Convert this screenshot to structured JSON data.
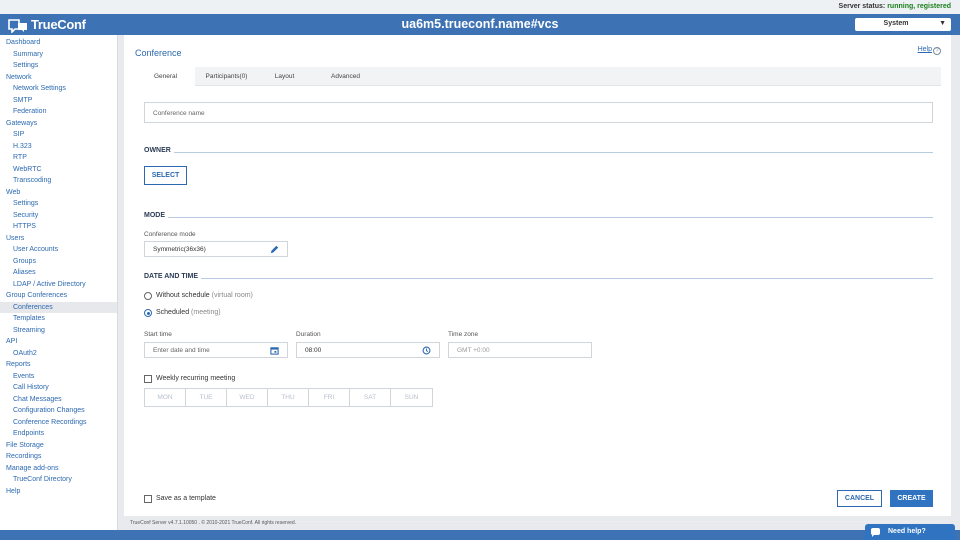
{
  "status": {
    "label": "Server status:",
    "value": "running, registered",
    "value_color": "#1a7f1a"
  },
  "header": {
    "logo_text": "TrueConf",
    "server_id": "ua6m5.trueconf.name#vcs",
    "role_select": "System",
    "bg_color": "#3d72b4"
  },
  "sidebar": [
    {
      "label": "Dashboard",
      "level": 1
    },
    {
      "label": "Summary",
      "level": 2
    },
    {
      "label": "Settings",
      "level": 2
    },
    {
      "label": "Network",
      "level": 1
    },
    {
      "label": "Network Settings",
      "level": 2
    },
    {
      "label": "SMTP",
      "level": 2
    },
    {
      "label": "Federation",
      "level": 2
    },
    {
      "label": "Gateways",
      "level": 1
    },
    {
      "label": "SIP",
      "level": 2
    },
    {
      "label": "H.323",
      "level": 2
    },
    {
      "label": "RTP",
      "level": 2
    },
    {
      "label": "WebRTC",
      "level": 2
    },
    {
      "label": "Transcoding",
      "level": 2
    },
    {
      "label": "Web",
      "level": 1
    },
    {
      "label": "Settings",
      "level": 2
    },
    {
      "label": "Security",
      "level": 2
    },
    {
      "label": "HTTPS",
      "level": 2
    },
    {
      "label": "Users",
      "level": 1
    },
    {
      "label": "User Accounts",
      "level": 2
    },
    {
      "label": "Groups",
      "level": 2
    },
    {
      "label": "Aliases",
      "level": 2
    },
    {
      "label": "LDAP / Active Directory",
      "level": 2
    },
    {
      "label": "Group Conferences",
      "level": 1
    },
    {
      "label": "Conferences",
      "level": 2,
      "active": true
    },
    {
      "label": "Templates",
      "level": 2
    },
    {
      "label": "Streaming",
      "level": 2
    },
    {
      "label": "API",
      "level": 1
    },
    {
      "label": "OAuth2",
      "level": 2
    },
    {
      "label": "Reports",
      "level": 1
    },
    {
      "label": "Events",
      "level": 2
    },
    {
      "label": "Call History",
      "level": 2
    },
    {
      "label": "Chat Messages",
      "level": 2
    },
    {
      "label": "Configuration Changes",
      "level": 2
    },
    {
      "label": "Conference Recordings",
      "level": 2
    },
    {
      "label": "Endpoints",
      "level": 2
    },
    {
      "label": "File Storage",
      "level": 1
    },
    {
      "label": "Recordings",
      "level": 1
    },
    {
      "label": "Manage add-ons",
      "level": 1
    },
    {
      "label": "TrueConf Directory",
      "level": 2
    },
    {
      "label": "Help",
      "level": 1
    }
  ],
  "page": {
    "title": "Conference",
    "help": "Help"
  },
  "tabs": [
    {
      "label": "General",
      "active": true
    },
    {
      "label": "Participants(0)"
    },
    {
      "label": "Layout"
    },
    {
      "label": "Advanced"
    }
  ],
  "form": {
    "conference_name_placeholder": "Conference name",
    "owner": {
      "section": "OWNER",
      "select_button": "SELECT"
    },
    "mode": {
      "section": "MODE",
      "label": "Conference mode",
      "value": "Symmetric(36x36)"
    },
    "datetime": {
      "section": "DATE AND TIME",
      "without_schedule": "Without schedule",
      "without_schedule_hint": "(virtual room)",
      "scheduled": "Scheduled",
      "scheduled_hint": "(meeting)",
      "start_time_label": "Start time",
      "start_time_placeholder": "Enter date and time",
      "duration_label": "Duration",
      "duration_value": "08:00",
      "timezone_label": "Time zone",
      "timezone_placeholder": "GMT +0:00",
      "weekly_label": "Weekly recurring meeting",
      "days": [
        "MON",
        "TUE",
        "WED",
        "THU",
        "FRI",
        "SAT",
        "SUN"
      ]
    },
    "save_template_label": "Save as a template",
    "cancel": "CANCEL",
    "create": "CREATE"
  },
  "footer": {
    "copyright": "TrueConf Server v4.7.1.10050 . © 2010-2021 TrueConf. All rights reserved."
  },
  "need_help": "Need help?"
}
